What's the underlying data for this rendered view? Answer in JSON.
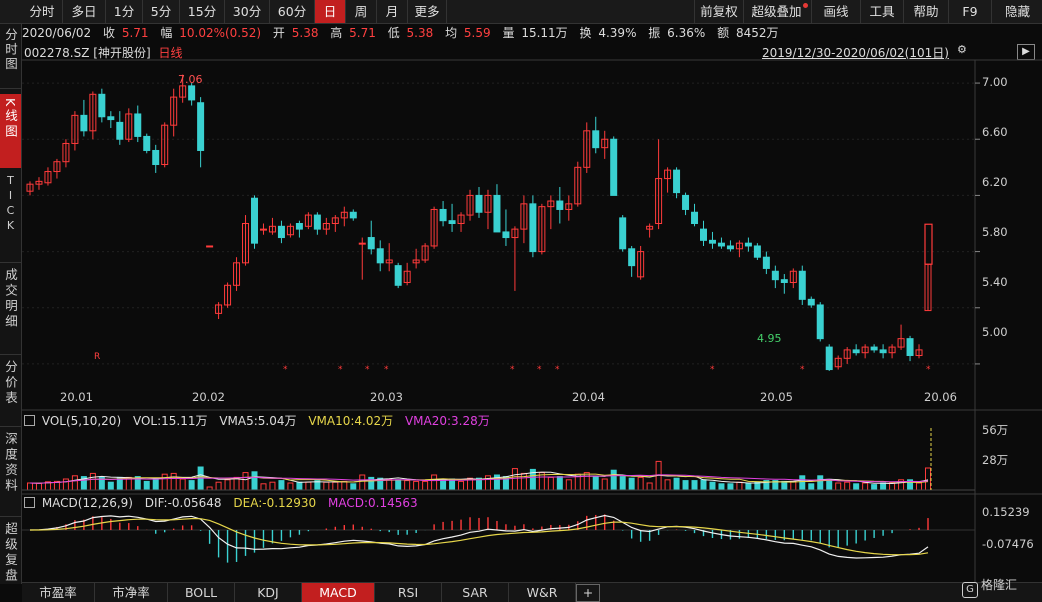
{
  "toolbar": {
    "periods": [
      "分时",
      "多日",
      "1分",
      "5分",
      "15分",
      "30分",
      "60分",
      "日",
      "周",
      "月",
      "更多"
    ],
    "active_period": "日",
    "right_buttons": [
      "前复权",
      "超级叠加",
      "画线",
      "工具",
      "帮助",
      "F9",
      "隐藏"
    ]
  },
  "quote": {
    "date": "2020/06/02",
    "close_label": "收",
    "close": "5.71",
    "change_label": "幅",
    "change": "10.02%(0.52)",
    "open_label": "开",
    "open": "5.38",
    "high_label": "高",
    "high": "5.71",
    "low_label": "低",
    "low": "5.38",
    "avg_label": "均",
    "avg": "5.59",
    "volume_label": "量",
    "volume": "15.11万",
    "turnover_label": "换",
    "turnover": "4.39%",
    "amplitude_label": "振",
    "amplitude": "6.36%",
    "amount_label": "额",
    "amount": "8452万"
  },
  "stock": {
    "code": "002278.SZ",
    "name": "[神开股份]",
    "period_label": "日线"
  },
  "range_label": "2019/12/30-2020/06/02(101日)",
  "sidebar": [
    "分时图",
    "K线图",
    "TICK",
    "成交明细",
    "分价表",
    "深度资料",
    "超级复盘"
  ],
  "sidebar_active": "K线图",
  "price_axis": [
    "7.00",
    "6.60",
    "6.20",
    "5.80",
    "5.40",
    "5.00"
  ],
  "date_axis": [
    "20.01",
    "20.02",
    "20.03",
    "20.04",
    "20.05",
    "20.06"
  ],
  "annotations": {
    "high": "7.06",
    "low": "4.95",
    "r_marker": "R"
  },
  "volume_panel": {
    "label": "VOL(5,10,20)",
    "vol": "VOL:15.11万",
    "vma5": "VMA5:5.04万",
    "vma10": "VMA10:4.02万",
    "vma20": "VMA20:3.28万",
    "axis": [
      "56万",
      "28万"
    ]
  },
  "macd_panel": {
    "label": "MACD(12,26,9)",
    "dif": "DIF:-0.05648",
    "dea": "DEA:-0.12930",
    "macd": "MACD:0.14563",
    "axis": [
      "0.15239",
      "-0.07476"
    ]
  },
  "bottom_tabs": [
    "市盈率",
    "市净率",
    "BOLL",
    "KDJ",
    "MACD",
    "RSI",
    "SAR",
    "W&R",
    "+"
  ],
  "bottom_active": "MACD",
  "brand": "格隆汇",
  "colors": {
    "up": "#ff3b3b",
    "down": "#3ad1d1",
    "dif": "#f0f0f0",
    "dea": "#e6d64a",
    "vma20": "#e040e0",
    "active": "#c21f1f"
  },
  "chart_data": {
    "type": "candlestick",
    "ohlc": [
      [
        6.23,
        6.3,
        6.2,
        6.28
      ],
      [
        6.28,
        6.33,
        6.24,
        6.3
      ],
      [
        6.29,
        6.4,
        6.27,
        6.37
      ],
      [
        6.37,
        6.46,
        6.32,
        6.44
      ],
      [
        6.44,
        6.6,
        6.4,
        6.57
      ],
      [
        6.57,
        6.8,
        6.52,
        6.77
      ],
      [
        6.77,
        6.88,
        6.62,
        6.66
      ],
      [
        6.66,
        6.94,
        6.6,
        6.92
      ],
      [
        6.92,
        6.96,
        6.72,
        6.76
      ],
      [
        6.76,
        6.8,
        6.68,
        6.74
      ],
      [
        6.72,
        6.8,
        6.56,
        6.6
      ],
      [
        6.6,
        6.82,
        6.58,
        6.78
      ],
      [
        6.78,
        6.84,
        6.58,
        6.62
      ],
      [
        6.62,
        6.64,
        6.5,
        6.52
      ],
      [
        6.52,
        6.56,
        6.36,
        6.42
      ],
      [
        6.42,
        6.72,
        6.4,
        6.7
      ],
      [
        6.7,
        6.96,
        6.62,
        6.9
      ],
      [
        6.9,
        7.06,
        6.86,
        6.98
      ],
      [
        6.98,
        7.0,
        6.84,
        6.88
      ],
      [
        6.86,
        6.9,
        6.4,
        6.52
      ],
      [
        5.84,
        5.84,
        5.84,
        5.84
      ],
      [
        5.36,
        5.44,
        5.32,
        5.42
      ],
      [
        5.42,
        5.58,
        5.4,
        5.56
      ],
      [
        5.56,
        5.76,
        5.52,
        5.72
      ],
      [
        5.72,
        6.06,
        5.7,
        6.0
      ],
      [
        6.18,
        6.2,
        5.82,
        5.86
      ],
      [
        5.96,
        6.0,
        5.92,
        5.96
      ],
      [
        5.94,
        6.04,
        5.92,
        5.98
      ],
      [
        5.98,
        6.02,
        5.86,
        5.9
      ],
      [
        5.92,
        6.0,
        5.9,
        5.98
      ],
      [
        6.0,
        6.02,
        5.9,
        5.96
      ],
      [
        5.98,
        6.08,
        5.96,
        6.06
      ],
      [
        6.06,
        6.08,
        5.92,
        5.96
      ],
      [
        5.96,
        6.04,
        5.92,
        6.0
      ],
      [
        6.0,
        6.06,
        5.94,
        6.04
      ],
      [
        6.04,
        6.12,
        5.98,
        6.08
      ],
      [
        6.08,
        6.1,
        6.02,
        6.04
      ],
      [
        5.86,
        5.9,
        5.6,
        5.86
      ],
      [
        5.9,
        6.02,
        5.78,
        5.82
      ],
      [
        5.82,
        5.88,
        5.66,
        5.72
      ],
      [
        5.72,
        5.86,
        5.66,
        5.74
      ],
      [
        5.7,
        5.72,
        5.54,
        5.56
      ],
      [
        5.58,
        5.72,
        5.56,
        5.66
      ],
      [
        5.72,
        5.82,
        5.68,
        5.74
      ],
      [
        5.74,
        5.86,
        5.72,
        5.84
      ],
      [
        5.84,
        6.12,
        5.82,
        6.1
      ],
      [
        6.1,
        6.16,
        5.98,
        6.02
      ],
      [
        6.02,
        6.14,
        5.94,
        6.0
      ],
      [
        6.0,
        6.08,
        5.94,
        6.06
      ],
      [
        6.06,
        6.24,
        6.02,
        6.2
      ],
      [
        6.2,
        6.26,
        6.04,
        6.08
      ],
      [
        6.08,
        6.24,
        5.96,
        6.2
      ],
      [
        6.2,
        6.28,
        5.98,
        5.94
      ],
      [
        5.94,
        6.1,
        5.84,
        5.9
      ],
      [
        5.9,
        5.98,
        5.52,
        5.96
      ],
      [
        5.96,
        6.2,
        5.86,
        6.14
      ],
      [
        6.14,
        6.2,
        5.76,
        5.8
      ],
      [
        5.8,
        6.14,
        5.78,
        6.12
      ],
      [
        6.12,
        6.2,
        5.96,
        6.16
      ],
      [
        6.16,
        6.26,
        6.0,
        6.1
      ],
      [
        6.1,
        6.2,
        6.02,
        6.14
      ],
      [
        6.14,
        6.44,
        6.12,
        6.4
      ],
      [
        6.4,
        6.72,
        6.36,
        6.66
      ],
      [
        6.66,
        6.76,
        6.5,
        6.54
      ],
      [
        6.54,
        6.66,
        6.46,
        6.6
      ],
      [
        6.6,
        6.62,
        6.2,
        6.2
      ],
      [
        6.04,
        6.06,
        5.8,
        5.82
      ],
      [
        5.82,
        5.84,
        5.62,
        5.7
      ],
      [
        5.62,
        5.84,
        5.6,
        5.8
      ],
      [
        5.96,
        6.0,
        5.9,
        5.98
      ],
      [
        6.0,
        6.6,
        5.96,
        6.32
      ],
      [
        6.32,
        6.4,
        6.22,
        6.38
      ],
      [
        6.38,
        6.4,
        6.18,
        6.22
      ],
      [
        6.2,
        6.22,
        6.06,
        6.1
      ],
      [
        6.08,
        6.14,
        5.98,
        6.0
      ],
      [
        5.96,
        6.02,
        5.84,
        5.88
      ],
      [
        5.88,
        5.94,
        5.82,
        5.86
      ],
      [
        5.86,
        5.9,
        5.82,
        5.84
      ],
      [
        5.84,
        5.88,
        5.8,
        5.82
      ],
      [
        5.82,
        5.88,
        5.76,
        5.86
      ],
      [
        5.86,
        5.9,
        5.8,
        5.84
      ],
      [
        5.84,
        5.86,
        5.74,
        5.76
      ],
      [
        5.76,
        5.8,
        5.64,
        5.68
      ],
      [
        5.66,
        5.7,
        5.54,
        5.6
      ],
      [
        5.6,
        5.64,
        5.5,
        5.58
      ],
      [
        5.58,
        5.68,
        5.54,
        5.66
      ],
      [
        5.66,
        5.7,
        5.42,
        5.46
      ],
      [
        5.46,
        5.48,
        5.4,
        5.42
      ],
      [
        5.42,
        5.44,
        5.16,
        5.18
      ],
      [
        5.12,
        5.14,
        4.95,
        4.96
      ],
      [
        4.98,
        5.06,
        4.96,
        5.04
      ],
      [
        5.04,
        5.12,
        5.0,
        5.1
      ],
      [
        5.1,
        5.14,
        5.06,
        5.08
      ],
      [
        5.08,
        5.14,
        5.04,
        5.12
      ],
      [
        5.12,
        5.14,
        5.08,
        5.1
      ],
      [
        5.1,
        5.14,
        5.04,
        5.08
      ],
      [
        5.08,
        5.14,
        5.04,
        5.12
      ],
      [
        5.12,
        5.28,
        5.1,
        5.18
      ],
      [
        5.18,
        5.2,
        5.02,
        5.06
      ],
      [
        5.06,
        5.14,
        5.04,
        5.1
      ],
      [
        5.38,
        5.71,
        5.38,
        5.71
      ]
    ],
    "y_axis": [
      "7.00",
      "6.60",
      "6.20",
      "5.80",
      "5.40",
      "5.00"
    ],
    "ylim": [
      4.85,
      7.15
    ],
    "x_ticks": [
      "20.01",
      "20.02",
      "20.03",
      "20.04",
      "20.05",
      "20.06"
    ]
  }
}
